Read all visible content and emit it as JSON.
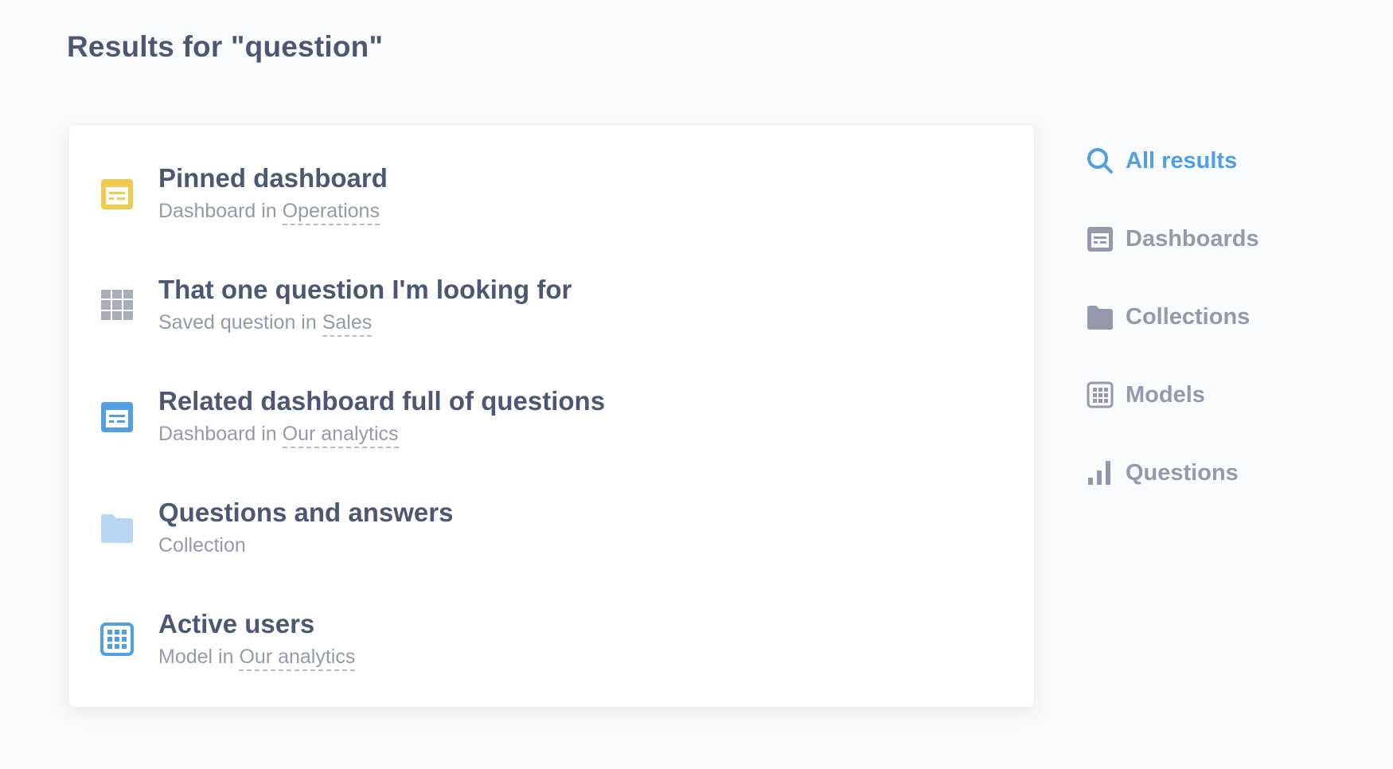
{
  "page": {
    "title": "Results for \"question\""
  },
  "results": [
    {
      "title": "Pinned dashboard",
      "type_text": "Dashboard in ",
      "collection": "Operations",
      "icon": "dashboard-icon",
      "color": "#f2ca4d"
    },
    {
      "title": "That one question I'm looking for",
      "type_text": "Saved question in ",
      "collection": "Sales",
      "icon": "table-grid-icon",
      "color": "#a8adba"
    },
    {
      "title": "Related dashboard full of questions",
      "type_text": "Dashboard in ",
      "collection": "Our analytics",
      "icon": "dashboard-icon",
      "color": "#509ee3"
    },
    {
      "title": "Questions and answers",
      "type_text": "Collection",
      "collection": "",
      "icon": "folder-icon",
      "color": "#b8d5f3"
    },
    {
      "title": "Active users",
      "type_text": "Model in ",
      "collection": "Our analytics",
      "icon": "model-icon",
      "color": "#509ee3"
    }
  ],
  "filters": [
    {
      "label": "All results",
      "icon": "search-icon",
      "active": true
    },
    {
      "label": "Dashboards",
      "icon": "dashboard-icon",
      "active": false
    },
    {
      "label": "Collections",
      "icon": "folder-icon",
      "active": false
    },
    {
      "label": "Models",
      "icon": "model-icon",
      "active": false
    },
    {
      "label": "Questions",
      "icon": "bar-chart-icon",
      "active": false
    }
  ],
  "colors": {
    "accent": "#509ee3",
    "text_dark": "#4c5773",
    "text_muted": "#949aab",
    "filter_icon": "#949aab"
  }
}
